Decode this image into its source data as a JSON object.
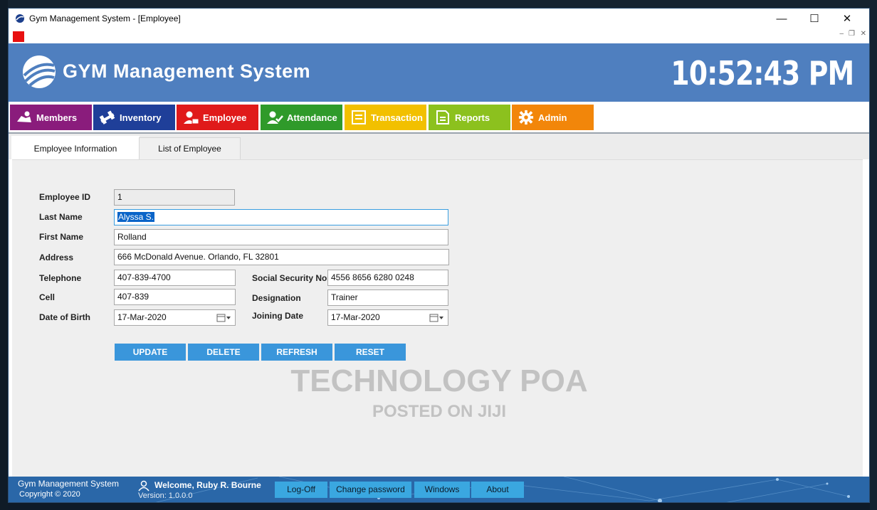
{
  "window": {
    "title": "Gym Management System - [Employee]",
    "controls": {
      "minimize": "—",
      "maximize": "☐",
      "close": "✕"
    },
    "mdi_controls": {
      "minimize": "–",
      "restore": "❐",
      "close": "✕"
    }
  },
  "banner": {
    "title": "GYM Management System",
    "clock": "10:52:43 PM"
  },
  "nav": {
    "items": [
      {
        "label": "Members",
        "color": "#8a1c7c",
        "icon": "members-icon"
      },
      {
        "label": "Inventory",
        "color": "#1f3f99",
        "icon": "inventory-icon"
      },
      {
        "label": "Employee",
        "color": "#e01a1a",
        "icon": "employee-icon"
      },
      {
        "label": "Attendance",
        "color": "#2f9a2a",
        "icon": "attendance-icon"
      },
      {
        "label": "Transaction",
        "color": "#f2c000",
        "icon": "transaction-icon"
      },
      {
        "label": "Reports",
        "color": "#8cc11e",
        "icon": "reports-icon"
      },
      {
        "label": "Admin",
        "color": "#f2860a",
        "icon": "admin-gear-icon"
      }
    ]
  },
  "tabs": {
    "info": "Employee Information",
    "list": "List of Employee"
  },
  "form": {
    "employee_id": {
      "label": "Employee ID",
      "value": "1"
    },
    "last_name": {
      "label": "Last Name",
      "value": "Alyssa S."
    },
    "first_name": {
      "label": "First Name",
      "value": "Rolland"
    },
    "address": {
      "label": "Address",
      "value": "666 McDonald Avenue. Orlando, FL 32801"
    },
    "telephone": {
      "label": "Telephone",
      "value": "407-839-4700"
    },
    "cell": {
      "label": "Cell",
      "value": "407-839"
    },
    "date_of_birth": {
      "label": "Date of Birth",
      "value": "17-Mar-2020"
    },
    "ssn": {
      "label": "Social Security No",
      "value": "4556 8656 6280 0248"
    },
    "designation": {
      "label": "Designation",
      "value": "Trainer"
    },
    "joining_date": {
      "label": "Joining Date",
      "value": "17-Mar-2020"
    }
  },
  "buttons": {
    "update": "UPDATE",
    "delete": "DELETE",
    "refresh": "REFRESH",
    "reset": "RESET"
  },
  "watermark": {
    "line1": "TECHNOLOGY POA",
    "line2": "POSTED ON JIJI"
  },
  "status": {
    "app_name": "Gym Management System",
    "copyright": "Copyright  © 2020",
    "welcome": "Welcome, Ruby R. Bourne",
    "version": "Version: 1.0.0.0",
    "buttons": [
      "Log-Off",
      "Change password",
      "Windows",
      "About"
    ]
  }
}
